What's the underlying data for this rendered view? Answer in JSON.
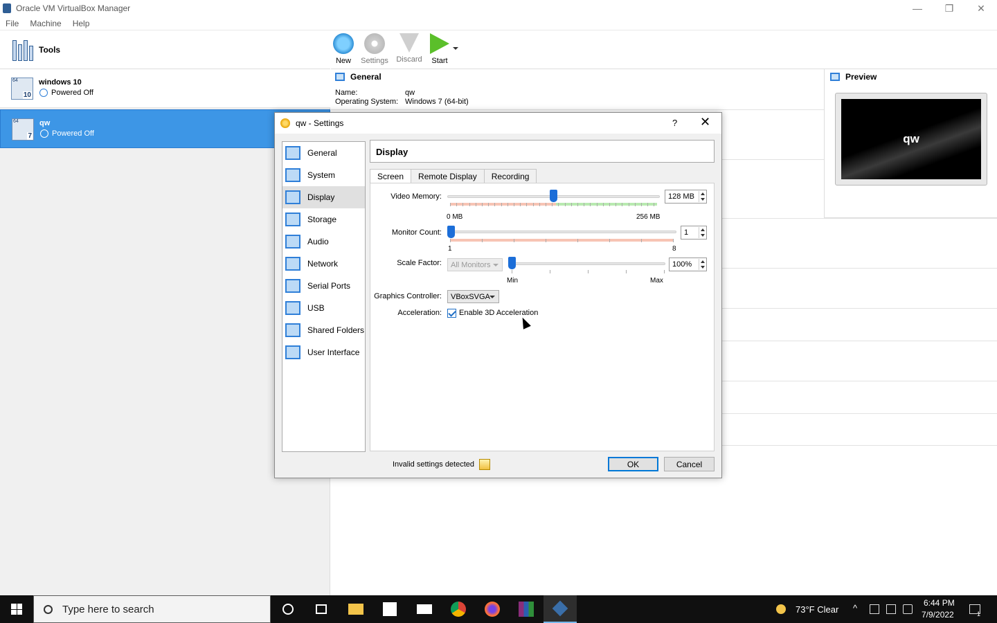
{
  "window": {
    "title": "Oracle VM VirtualBox Manager",
    "controls": [
      "—",
      "❐",
      "✕"
    ]
  },
  "menu": [
    "File",
    "Machine",
    "Help"
  ],
  "tools": {
    "label": "Tools"
  },
  "vms": [
    {
      "name": "windows 10",
      "state": "Powered Off",
      "badge_bits": "64",
      "badge_ver": "10"
    },
    {
      "name": "qw",
      "state": "Powered Off",
      "badge_bits": "64",
      "badge_ver": "7"
    }
  ],
  "toolbar": {
    "new": "New",
    "settings": "Settings",
    "discard": "Discard",
    "start": "Start"
  },
  "general": {
    "heading": "General",
    "name_label": "Name:",
    "name_value": "qw",
    "os_label": "Operating System:",
    "os_value": "Windows 7 (64-bit)"
  },
  "preview": {
    "heading": "Preview",
    "screen_text": "qw"
  },
  "dialog": {
    "title": "qw - Settings",
    "help": "?",
    "close": "✕",
    "categories": [
      "General",
      "System",
      "Display",
      "Storage",
      "Audio",
      "Network",
      "Serial Ports",
      "USB",
      "Shared Folders",
      "User Interface"
    ],
    "active_category": "Display",
    "page_title": "Display",
    "tabs": [
      "Screen",
      "Remote Display",
      "Recording"
    ],
    "active_tab": "Screen",
    "video_memory": {
      "label": "Video Memory:",
      "value": "128 MB",
      "min_label": "0 MB",
      "max_label": "256 MB",
      "fraction": 0.5
    },
    "monitor_count": {
      "label": "Monitor Count:",
      "value": "1",
      "min_label": "1",
      "max_label": "8",
      "fraction": 0
    },
    "scale_factor": {
      "label": "Scale Factor:",
      "monitor_select": "All Monitors",
      "value": "100%",
      "min_label": "Min",
      "max_label": "Max",
      "fraction": 0
    },
    "graphics_controller": {
      "label": "Graphics Controller:",
      "value": "VBoxSVGA"
    },
    "acceleration": {
      "label": "Acceleration:",
      "checkbox_label": "Enable 3D Acceleration",
      "checked": true
    },
    "invalid_text": "Invalid settings detected",
    "ok": "OK",
    "cancel": "Cancel"
  },
  "taskbar": {
    "search_placeholder": "Type here to search",
    "weather": "73°F  Clear",
    "time": "6:44 PM",
    "date": "7/9/2022",
    "notification_count": "1"
  }
}
